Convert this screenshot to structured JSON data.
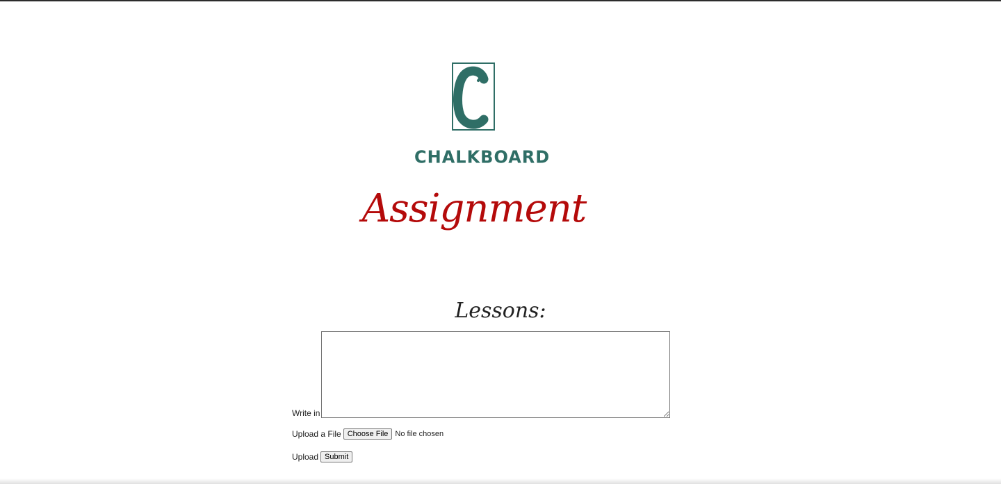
{
  "brand": {
    "logo_letter": "C",
    "logo_text": "CHALKBOARD",
    "color": "#2f6e66"
  },
  "page": {
    "title": "Assignment",
    "title_color": "#b40a0a"
  },
  "lessons": {
    "heading": "Lessons:",
    "write_label": "Write in",
    "write_value": "",
    "upload_label": "Upload a File",
    "choose_file_label": "Choose File",
    "file_status": "No file chosen",
    "submit_row_label": "Upload",
    "submit_label": "Submit"
  }
}
